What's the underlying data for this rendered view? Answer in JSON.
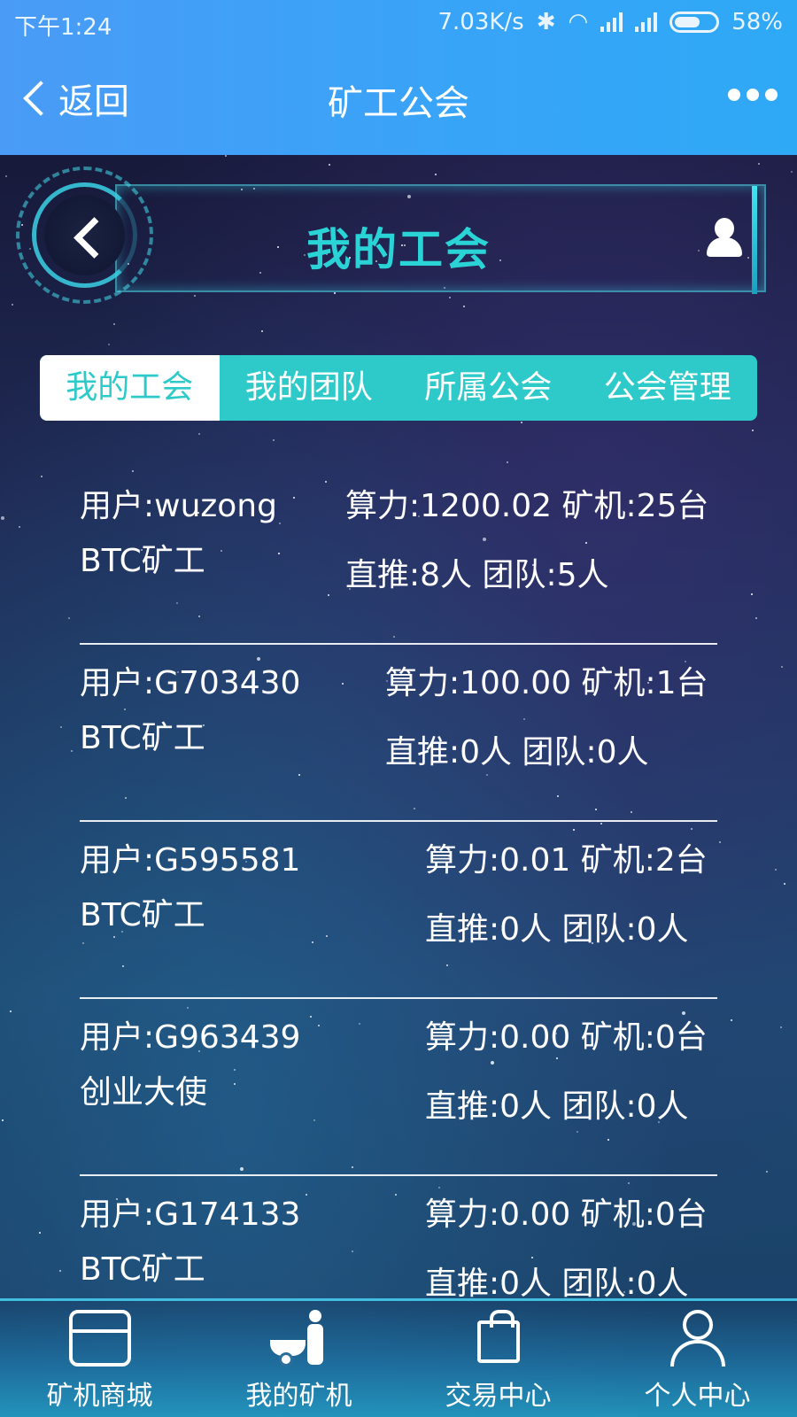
{
  "status_bar": {
    "time": "下午1:24",
    "network_speed": "7.03K/s",
    "battery": "58%"
  },
  "header": {
    "back_label": "返回",
    "title": "矿工公会"
  },
  "banner": {
    "title": "我的工会"
  },
  "tabs": [
    {
      "label": "我的工会",
      "active": true
    },
    {
      "label": "我的团队",
      "active": false
    },
    {
      "label": "所属公会",
      "active": false
    },
    {
      "label": "公会管理",
      "active": false
    }
  ],
  "members": [
    {
      "user": "用户:wuzong",
      "role": "BTC矿工",
      "stats1": "算力:1200.02 矿机:25台",
      "stats2": "直推:8人 团队:5人"
    },
    {
      "user": "用户:G703430",
      "role": "BTC矿工",
      "stats1": "算力:100.00 矿机:1台",
      "stats2": "直推:0人 团队:0人"
    },
    {
      "user": "用户:G595581",
      "role": "BTC矿工",
      "stats1": "算力:0.01 矿机:2台",
      "stats2": "直推:0人 团队:0人"
    },
    {
      "user": "用户:G963439",
      "role": "创业大使",
      "stats1": "算力:0.00 矿机:0台",
      "stats2": "直推:0人 团队:0人"
    },
    {
      "user": "用户:G174133",
      "role": "BTC矿工",
      "stats1": "算力:0.00 矿机:0台",
      "stats2": "直推:0人 团队:0人"
    }
  ],
  "bottom_nav": [
    {
      "label": "矿机商城",
      "icon": "shop-icon"
    },
    {
      "label": "我的矿机",
      "icon": "miner-icon"
    },
    {
      "label": "交易中心",
      "icon": "shopping-bag-icon"
    },
    {
      "label": "个人中心",
      "icon": "person-icon"
    }
  ],
  "colors": {
    "header_blue": "#3aa3f8",
    "accent_teal": "#2ec9c9"
  }
}
